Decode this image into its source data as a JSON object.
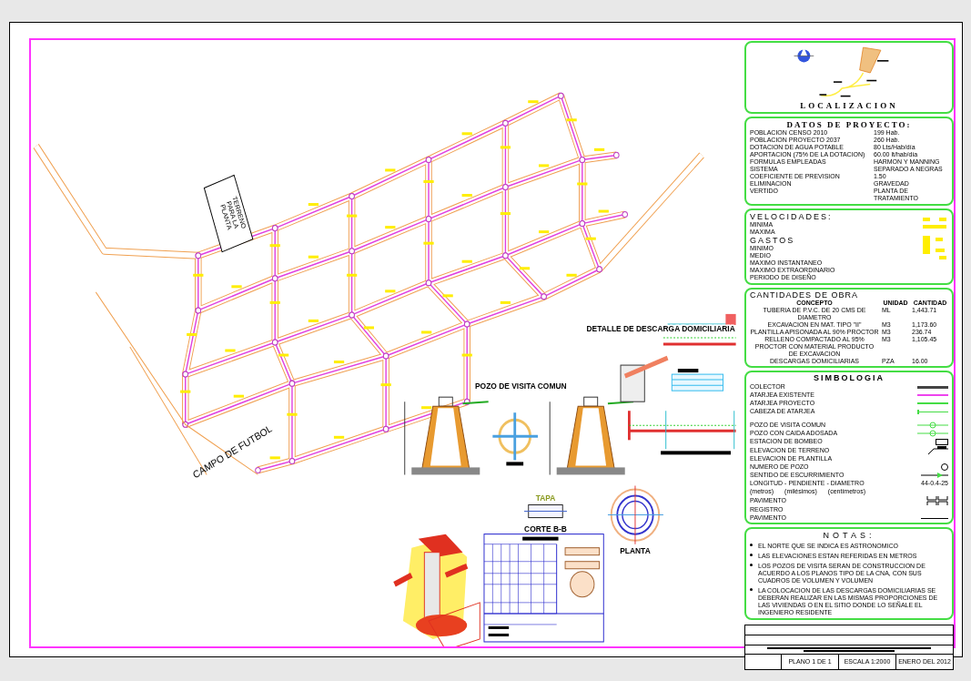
{
  "plan_labels": [
    {
      "kind": "terreno",
      "text": "TERRENO PARA LA PLANTA"
    },
    {
      "kind": "campo",
      "text": "CAMPO DE FUTBOL"
    }
  ],
  "detail_titles": [
    {
      "kind": "descarga",
      "text": "DETALLE DE DESCARGA DOMICILIARIA"
    },
    {
      "kind": "pozo",
      "text": "POZO DE VISITA COMUN"
    },
    {
      "kind": "tapa",
      "text": "TAPA"
    },
    {
      "kind": "corte",
      "text": "CORTE B-B"
    },
    {
      "kind": "planta",
      "text": "PLANTA"
    }
  ],
  "localizacion": {
    "title": "LOCALIZACION"
  },
  "datos_proyecto": {
    "title": "DATOS DE PROYECTO:",
    "rows": [
      {
        "label": "POBLACION CENSO 2010",
        "value": "199 Hab."
      },
      {
        "label": "POBLACION PROYECTO 2037",
        "value": "260 Hab."
      },
      {
        "label": "DOTACION DE AGUA POTABLE",
        "value": "80 Lts/Hab/día"
      },
      {
        "label": "APORTACION (75% DE LA DOTACION)",
        "value": "60.00 lt/hab/día"
      },
      {
        "label": "FORMULAS EMPLEADAS",
        "value": "HARMON Y MANNING"
      },
      {
        "label": "SISTEMA",
        "value": "SEPARADO A NEGRAS"
      },
      {
        "label": "COEFICIENTE DE PREVISION",
        "value": "1.50"
      },
      {
        "label": "ELIMINACION",
        "value": "GRAVEDAD"
      },
      {
        "label": "VERTIDO",
        "value": "PLANTA DE TRATAMIENTO"
      }
    ]
  },
  "velocidades": {
    "title": "VELOCIDADES:",
    "items": [
      "MINIMA",
      "MAXIMA"
    ],
    "gastos_title": "GASTOS",
    "gastos": [
      "MINIMO",
      "MEDIO",
      "MAXIMO INSTANTANEO",
      "MAXIMO EXTRAORDINARIO",
      "PERIODO DE DISEÑO"
    ]
  },
  "cantidades": {
    "title": "CANTIDADES DE OBRA",
    "columns": [
      "CONCEPTO",
      "UNIDAD",
      "CANTIDAD"
    ],
    "rows": [
      {
        "concepto": "TUBERIA DE P.V.C. DE 20 CMS DE DIAMETRO",
        "unidad": "ML",
        "cantidad": "1,443.71"
      },
      {
        "concepto": "EXCAVACION EN MAT. TIPO \"II\"",
        "unidad": "M3",
        "cantidad": "1,173.60"
      },
      {
        "concepto": "PLANTILLA APISONADA AL 90% PROCTOR",
        "unidad": "M3",
        "cantidad": "236.74"
      },
      {
        "concepto": "RELLENO COMPACTADO AL 95% PROCTOR CON MATERIAL PRODUCTO DE EXCAVACION",
        "unidad": "M3",
        "cantidad": "1,105.45"
      },
      {
        "concepto": "DESCARGAS DOMICILIARIAS",
        "unidad": "PZA",
        "cantidad": "16.00"
      }
    ]
  },
  "simbologia": {
    "title": "SIMBOLOGIA",
    "rows": [
      {
        "kind": "bar",
        "label": "COLECTOR"
      },
      {
        "kind": "magenta",
        "label": "ATARJEA EXISTENTE"
      },
      {
        "kind": "green",
        "label": "ATARJEA PROYECTO"
      },
      {
        "kind": "head",
        "label": "CABEZA DE ATARJEA"
      },
      {
        "kind": "gap"
      },
      {
        "kind": "pozo",
        "label": "POZO DE VISITA COMUN"
      },
      {
        "kind": "pozo",
        "label": "POZO CON CAIDA ADOSADA"
      },
      {
        "kind": "pump",
        "label": "ESTACION DE BOMBEO"
      },
      {
        "kind": "elev",
        "label": "ELEVACION DE TERRENO"
      },
      {
        "kind": "none",
        "label": "ELEVACION DE PLANTILLA"
      },
      {
        "kind": "num",
        "label": "NUMERO DE POZO"
      },
      {
        "kind": "arrow",
        "label": "SENTIDO DE ESCURRIMIENTO"
      },
      {
        "kind": "text",
        "label": "LONGITUD - PENDIENTE - DIAMETRO",
        "value": "44-0.4-25"
      },
      {
        "kind": "units",
        "parts": [
          "(metros)",
          "(milésimos)",
          "(centímetros)"
        ]
      },
      {
        "kind": "pav",
        "label": "PAVIMENTO"
      },
      {
        "kind": "none",
        "label": "REGISTRO"
      },
      {
        "kind": "line",
        "label": "PAVIMENTO"
      }
    ]
  },
  "notas": {
    "title": "NOTAS:",
    "items": [
      "EL NORTE QUE SE INDICA ES ASTRONOMICO",
      "LAS ELEVACIONES ESTAN REFERIDAS EN METROS",
      "LOS POZOS DE VISITA SERAN DE CONSTRUCCION DE ACUERDO A LOS PLANOS TIPO DE LA CNA, CON SUS CUADROS DE VOLUMEN Y VOLUMEN",
      "LA COLOCACION DE LAS DESCARGAS DOMICILIARIAS SE DEBERAN REALIZAR EN LAS MISMAS PROPORCIONES DE LAS VIVIENDAS O EN EL SITIO DONDE LO SEÑALE EL INGENIERO RESIDENTE"
    ]
  },
  "title_block": {
    "cells": [
      "PLANO 1 DE 1",
      "ESCALA 1:2000",
      "ENERO DEL 2012"
    ]
  }
}
